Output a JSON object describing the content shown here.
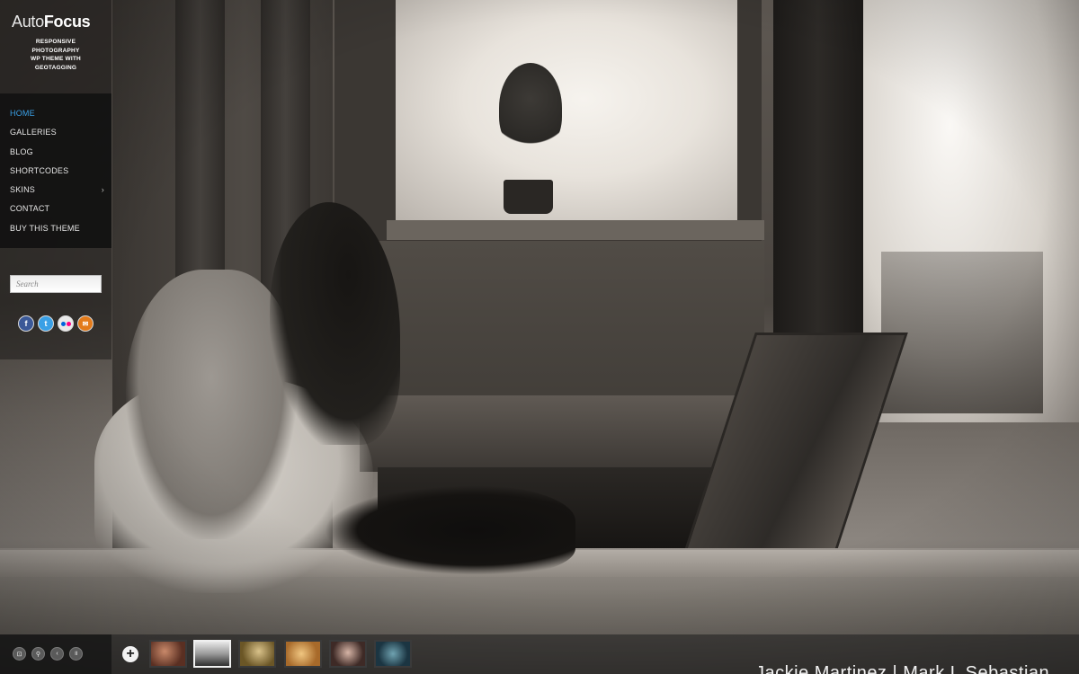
{
  "theme": {
    "accent": "#3aa0e6",
    "menu_bg": "#101010",
    "text": "#e6e6e6"
  },
  "logo": {
    "auto": "Auto",
    "focus": "Focus",
    "tagline": "RESPONSIVE PHOTOGRAPHY WP THEME WITH GEOTAGGING"
  },
  "menu": {
    "items": [
      {
        "label": "HOME",
        "active": true
      },
      {
        "label": "GALLERIES"
      },
      {
        "label": "BLOG"
      },
      {
        "label": "SHORTCODES"
      },
      {
        "label": "SKINS",
        "has_submenu": true
      },
      {
        "label": "CONTACT"
      },
      {
        "label": "BUY THIS THEME"
      }
    ],
    "submenu_glyph": "›"
  },
  "search": {
    "placeholder": "Search"
  },
  "social": [
    {
      "icon": "facebook-icon",
      "glyph": "f"
    },
    {
      "icon": "twitter-icon",
      "glyph": "t"
    },
    {
      "icon": "flickr-icon",
      "glyph": ""
    },
    {
      "icon": "email-icon",
      "glyph": "✉"
    }
  ],
  "controls": [
    {
      "icon": "fullscreen-icon",
      "glyph": "⊡"
    },
    {
      "icon": "map-pin-icon",
      "glyph": "⚲"
    },
    {
      "icon": "prev-icon",
      "glyph": "‹"
    },
    {
      "icon": "pause-icon",
      "glyph": "॥"
    }
  ],
  "thumbnails": {
    "plus_glyph": "+",
    "count": 6,
    "selected_index": 1
  },
  "caption": "Jackie Martinez  |  Mark L Sebastian"
}
